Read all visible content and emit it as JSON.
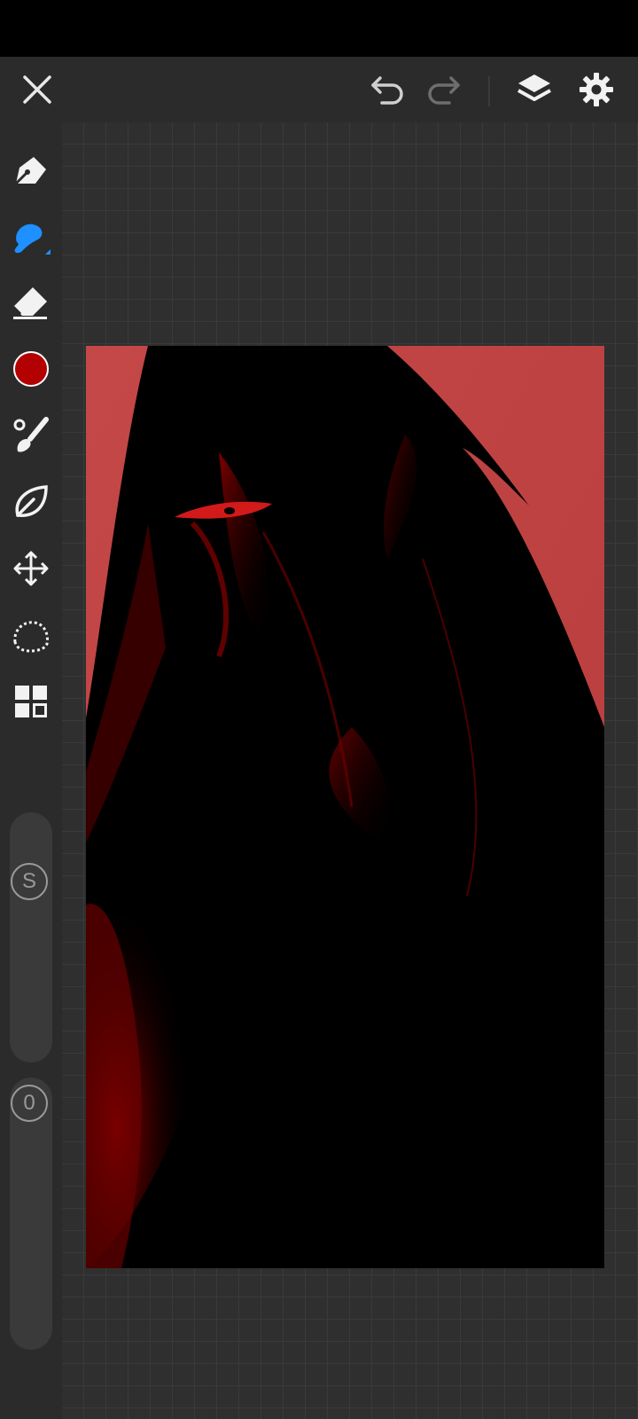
{
  "app": {
    "accent_color": "#1e90ff",
    "brush_color": "#b30000"
  },
  "topbar": {
    "close_icon": "close-icon",
    "undo_icon": "undo-icon",
    "redo_icon": "redo-icon",
    "layers_icon": "layers-icon",
    "settings_icon": "gear-icon"
  },
  "sidebar": {
    "tools": [
      {
        "name": "pen",
        "icon": "pen-nib-icon",
        "active": false
      },
      {
        "name": "brush",
        "icon": "brush-icon",
        "active": true
      },
      {
        "name": "eraser",
        "icon": "eraser-icon",
        "active": false
      },
      {
        "name": "color",
        "icon": "color-swatch",
        "active": false
      },
      {
        "name": "paint",
        "icon": "paintbrush-icon",
        "active": false
      },
      {
        "name": "leaf",
        "icon": "leaf-icon",
        "active": false
      },
      {
        "name": "transform",
        "icon": "move-icon",
        "active": false
      },
      {
        "name": "lasso",
        "icon": "lasso-icon",
        "active": false
      },
      {
        "name": "more",
        "icon": "grid-icon",
        "active": false
      }
    ],
    "size_slider_label": "S",
    "opacity_slider_label": "0"
  }
}
